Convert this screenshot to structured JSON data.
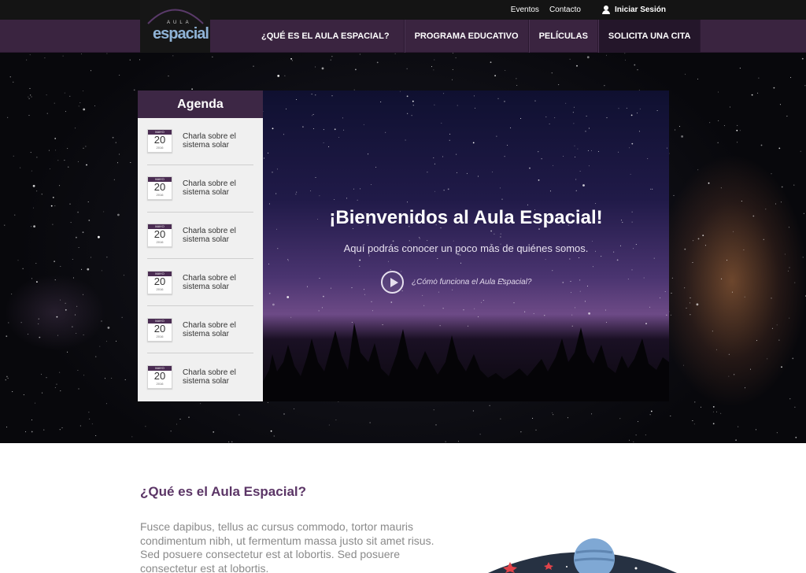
{
  "topbar": {
    "links": [
      "Eventos",
      "Contacto"
    ],
    "login_label": "Iniciar Sesión"
  },
  "logo": {
    "top_text": "AULA",
    "main_text": "espacial"
  },
  "nav": {
    "items": [
      "¿QUÉ ES EL AULA ESPACIAL?",
      "PROGRAMA EDUCATIVO",
      "PELÍCULAS",
      "SOLICITA UNA CITA"
    ]
  },
  "agenda": {
    "title": "Agenda",
    "items": [
      {
        "month": "MAYO",
        "day": "20",
        "year": "2016",
        "text": "Charla sobre el sistema solar"
      },
      {
        "month": "MAYO",
        "day": "20",
        "year": "2016",
        "text": "Charla sobre el sistema solar"
      },
      {
        "month": "MAYO",
        "day": "20",
        "year": "2016",
        "text": "Charla sobre el sistema solar"
      },
      {
        "month": "MAYO",
        "day": "20",
        "year": "2016",
        "text": "Charla sobre el sistema solar"
      },
      {
        "month": "MAYO",
        "day": "20",
        "year": "2016",
        "text": "Charla sobre el sistema solar"
      },
      {
        "month": "MAYO",
        "day": "20",
        "year": "2016",
        "text": "Charla sobre el sistema solar"
      }
    ]
  },
  "hero": {
    "title": "¡Bienvenidos al Aula Espacial!",
    "subtitle": "Aquí podrás conocer un poco más de quiénes somos.",
    "video_link": "¿Cómo funciona el Aula Espacial?"
  },
  "content": {
    "title": "¿Qué es el Aula Espacial?",
    "body": "Fusce dapibus, tellus ac cursus commodo, tortor mauris condimentum nibh, ut fermentum massa justo sit amet risus. Sed posuere consectetur est at lobortis. Sed posuere consectetur est at lobortis."
  },
  "colors": {
    "accent": "#3a2440",
    "title": "#5b3566",
    "topbar": "#141414"
  }
}
